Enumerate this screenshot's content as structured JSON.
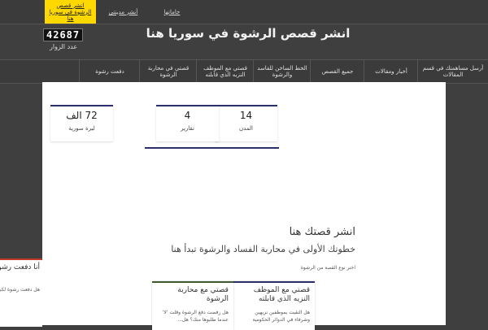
{
  "topbar": {
    "links": [
      {
        "label": "انشر قصص الرشوة في سوريا هنا",
        "active": true
      },
      {
        "label": "أنشر مدينتي",
        "active": false
      },
      {
        "label": "خاماتها",
        "active": false
      }
    ]
  },
  "header": {
    "title": "انشر قصص الرشوة في سوريا هنا",
    "counter": "42687",
    "counter_label": "عدد الزوار"
  },
  "nav": {
    "items": [
      "أرسل مساهمتك في قسم المقالات",
      "أخبار ومقالات",
      "جميع القصص",
      "الخط الساخن للفاسد والرشوة",
      "قصتي مع الموظف النزيه الذي قابلته",
      "قصتي في محاربة الرشوة",
      "دفعت رشوة"
    ]
  },
  "stats": [
    {
      "value": "14",
      "label": "المدن"
    },
    {
      "value": "4",
      "label": "تقارير"
    },
    {
      "value": "72 الف",
      "label": "ليرة سورية"
    }
  ],
  "cta": {
    "title": "انشر قصتك هنا",
    "subtitle": "خطوتك الأولى في محاربة الفساد والرشوة تبدأ هنا",
    "choose": "اختر نوع القصة من الرشوة"
  },
  "cards": [
    {
      "title": "قصتي مع الموظف النزيه الذي قابلته",
      "text": "هل التقيت بموظفين نزيهين وشرفاء في الدوائر الحكومية",
      "color": "#2a2f6b"
    },
    {
      "title": "قصتي مع محاربة الرشوة",
      "text": "هل رفضت دفع الرشوة وقلت 'لا' عندما طلبوها منك؟ هل...",
      "color": "#3e5a2e"
    }
  ],
  "side_card": {
    "title": "أنا دفعت رشوة",
    "text": "هل دفعت رشوة لكي يؤدى لك خدمة"
  }
}
